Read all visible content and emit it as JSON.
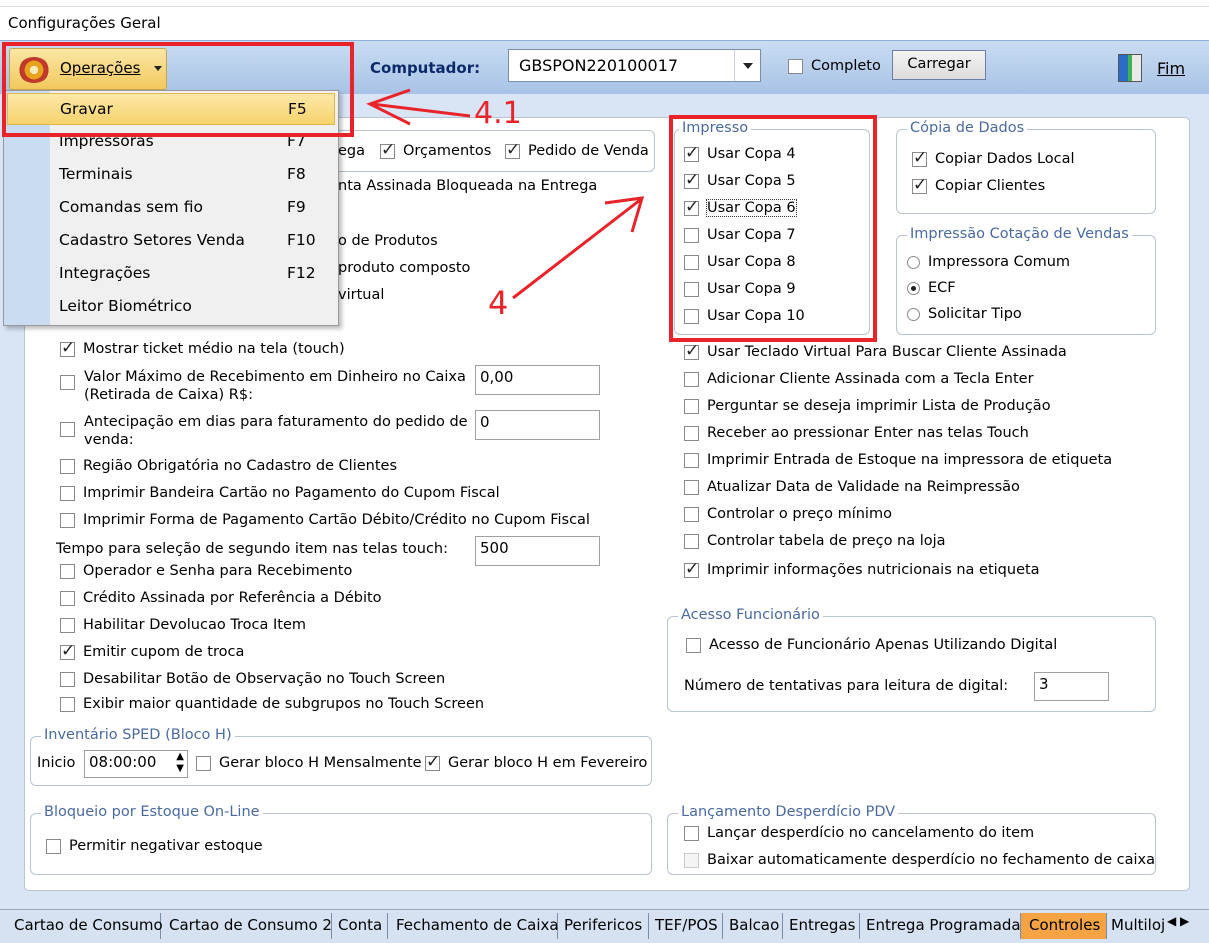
{
  "window": {
    "title": "Configurações Geral"
  },
  "toolbar": {
    "operations_label": "Operações",
    "computer_label": "Computador:",
    "computer_value": "GBSPON220100017",
    "complete_label": "Completo",
    "load_label": "Carregar",
    "exit_label": "Fim"
  },
  "menu": {
    "items": [
      {
        "label": "Gravar",
        "shortcut": "F5"
      },
      {
        "label": "Impressoras",
        "shortcut": "F7"
      },
      {
        "label": "Terminais",
        "shortcut": "F8"
      },
      {
        "label": "Comandas sem fio",
        "shortcut": "F9"
      },
      {
        "label": "Cadastro Setores Venda",
        "shortcut": "F10"
      },
      {
        "label": "Integrações",
        "shortcut": "F12"
      },
      {
        "label": "Leitor Biométrico",
        "shortcut": ""
      }
    ]
  },
  "annotations": {
    "a1": "4.1",
    "a2": "4"
  },
  "partial": {
    "t1": "ega",
    "t2": "Orçamentos",
    "t3": "Pedido de Venda",
    "t4": "nta Assinada Bloqueada na Entrega",
    "t5": "o de Produtos",
    "t6": "produto composto",
    "t7": "virtual"
  },
  "left_opts": {
    "ticket": "Mostrar ticket médio na tela (touch)",
    "valor_max": "Valor Máximo de Recebimento em Dinheiro no Caixa",
    "valor_max2": "(Retirada de Caixa) R$:",
    "valor_max_val": "0,00",
    "antecip": "Antecipação em dias para faturamento do pedido de",
    "antecip2": "venda:",
    "antecip_val": "0",
    "regiao": "Região Obrigatória no Cadastro de Clientes",
    "bandeira": "Imprimir Bandeira Cartão no Pagamento do Cupom Fiscal",
    "forma": "Imprimir Forma de Pagamento Cartão Débito/Crédito no Cupom Fiscal",
    "tempo_label": "Tempo para seleção de segundo item nas telas touch:",
    "tempo_val": "500",
    "operador": "Operador e Senha para Recebimento",
    "credito": "Crédito Assinada por Referência a Débito",
    "devolucao": "Habilitar Devolucao Troca Item",
    "cupom_troca": "Emitir cupom de troca",
    "desab_obs": "Desabilitar Botão de Observação no Touch Screen",
    "exibir_sub": "Exibir maior quantidade de subgrupos no Touch Screen"
  },
  "inventario": {
    "title": "Inventário SPED (Bloco H)",
    "inicio": "Inicio",
    "time": "08:00:00",
    "mensal": "Gerar bloco H Mensalmente",
    "fevereiro": "Gerar bloco H em Fevereiro"
  },
  "bloqueio": {
    "title": "Bloqueio por Estoque On-Line",
    "negativar": "Permitir negativar estoque"
  },
  "impresso": {
    "title": "Impresso",
    "items": [
      "Usar Copa 4",
      "Usar Copa 5",
      "Usar Copa 6",
      "Usar Copa 7",
      "Usar Copa 8",
      "Usar Copa 9",
      "Usar Copa 10"
    ]
  },
  "copia": {
    "title": "Cópia de Dados",
    "local": "Copiar Dados Local",
    "clientes": "Copiar Clientes"
  },
  "cotacao": {
    "title": "Impressão Cotação de Vendas",
    "opts": [
      "Impressora Comum",
      "ECF",
      "Solicitar Tipo"
    ]
  },
  "right_opts": [
    "Usar Teclado Virtual Para Buscar Cliente Assinada",
    "Adicionar Cliente Assinada com a Tecla Enter",
    "Perguntar se deseja imprimir Lista de Produção",
    "Receber ao pressionar Enter nas telas Touch",
    "Imprimir Entrada de Estoque na impressora de etiqueta",
    "Atualizar Data de Validade na Reimpressão",
    "Controlar o preço mínimo",
    "Controlar tabela de preço na loja",
    "Imprimir informações nutricionais na etiqueta"
  ],
  "acesso": {
    "title": "Acesso Funcionário",
    "digital": "Acesso de Funcionário Apenas Utilizando Digital",
    "tentativas": "Número de tentativas para leitura de digital:",
    "tentativas_val": "3"
  },
  "desperdicio": {
    "title": "Lançamento Desperdício PDV",
    "cancel": "Lançar desperdício no cancelamento do item",
    "fechamento": "Baixar automaticamente desperdício no fechamento de caixa"
  },
  "tabs": [
    "Cartao de Consumo",
    "Cartao de Consumo 2",
    "Conta",
    "Fechamento de Caixa",
    "Perifericos",
    "TEF/POS",
    "Balcao",
    "Entregas",
    "Entrega Programada",
    "Controles",
    "Multiloj"
  ],
  "colors": {
    "accent": "#f6a443",
    "annotation": "#e8232a"
  }
}
